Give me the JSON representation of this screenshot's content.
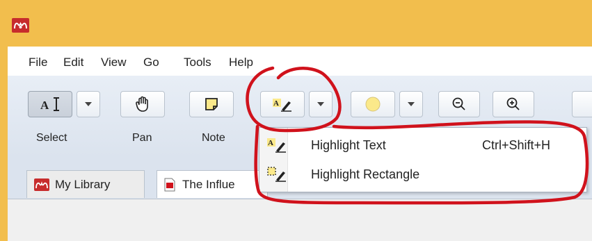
{
  "menu": {
    "items": [
      "File",
      "Edit",
      "View",
      "Go",
      "Tools",
      "Help"
    ]
  },
  "toolbar": {
    "labels": {
      "select": "Select",
      "pan": "Pan",
      "note": "Note"
    },
    "highlight_color": "#fbe98a",
    "icons": [
      "text-select-icon",
      "hand-pan-icon",
      "sticky-note-icon",
      "highlighter-icon",
      "color-swatch-icon",
      "zoom-out-icon",
      "zoom-in-icon"
    ]
  },
  "tabs": [
    {
      "label": "My Library",
      "icon": "library-logo-icon"
    },
    {
      "label": "The Influe",
      "icon": "pdf-document-icon"
    }
  ],
  "dropdown": {
    "items": [
      {
        "label": "Highlight Text",
        "shortcut": "Ctrl+Shift+H",
        "icon": "highlight-text-icon"
      },
      {
        "label": "Highlight Rectangle",
        "shortcut": "",
        "icon": "highlight-rectangle-icon"
      }
    ]
  },
  "colors": {
    "titlebar": "#f2be4d",
    "brand": "#c72c2c",
    "annotation": "#d0121c"
  }
}
